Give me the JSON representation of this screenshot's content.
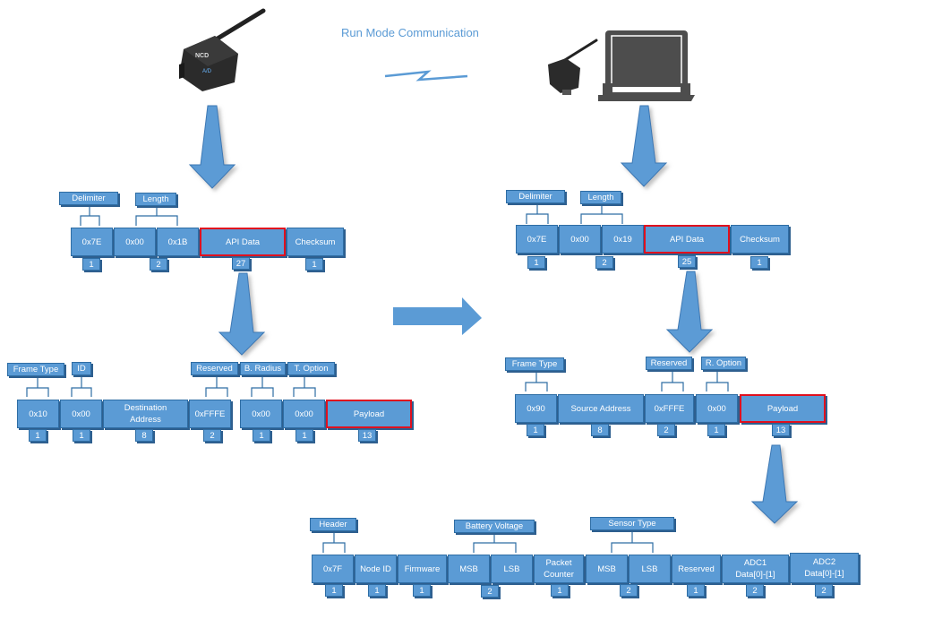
{
  "title": "Run Mode Communication",
  "colors": {
    "box": "#5b9bd5",
    "border": "#2e6da4",
    "highlight": "#e0101e",
    "title": "#5b9bd5"
  },
  "device_left": {
    "brand": "NCD",
    "label": "A/D"
  },
  "tx_frame": {
    "labels": [
      "Delimiter",
      "Length"
    ],
    "fields": [
      "0x7E",
      "0x00",
      "0x1B",
      "API Data",
      "Checksum"
    ],
    "sizes": [
      "1",
      "2",
      "27",
      "1"
    ]
  },
  "tx_api": {
    "labels": [
      "Frame Type",
      "ID",
      "Reserved",
      "B. Radius",
      "T. Option"
    ],
    "fields": [
      "0x10",
      "0x00",
      "Destination Address",
      "0xFFFE",
      "0x00",
      "0x00",
      "Payload"
    ],
    "sizes": [
      "1",
      "1",
      "8",
      "2",
      "1",
      "1",
      "13"
    ]
  },
  "rx_frame": {
    "labels": [
      "Delimiter",
      "Length"
    ],
    "fields": [
      "0x7E",
      "0x00",
      "0x19",
      "API Data",
      "Checksum"
    ],
    "sizes": [
      "1",
      "2",
      "25",
      "1"
    ]
  },
  "rx_api": {
    "labels": [
      "Frame Type",
      "Reserved",
      "R. Option"
    ],
    "fields": [
      "0x90",
      "Source Address",
      "0xFFFE",
      "0x00",
      "Payload"
    ],
    "sizes": [
      "1",
      "8",
      "2",
      "1",
      "13"
    ]
  },
  "payload": {
    "labels": [
      "Header",
      "Battery Voltage",
      "Sensor Type"
    ],
    "fields": [
      "0x7F",
      "Node ID",
      "Firmware",
      "MSB",
      "LSB",
      "Packet Counter",
      "MSB",
      "LSB",
      "Reserved",
      "ADC1 Data[0]-[1]",
      "ADC2 Data[0]-[1]"
    ],
    "sizes": [
      "1",
      "1",
      "1",
      "2",
      "1",
      "2",
      "1",
      "2",
      "2"
    ]
  }
}
